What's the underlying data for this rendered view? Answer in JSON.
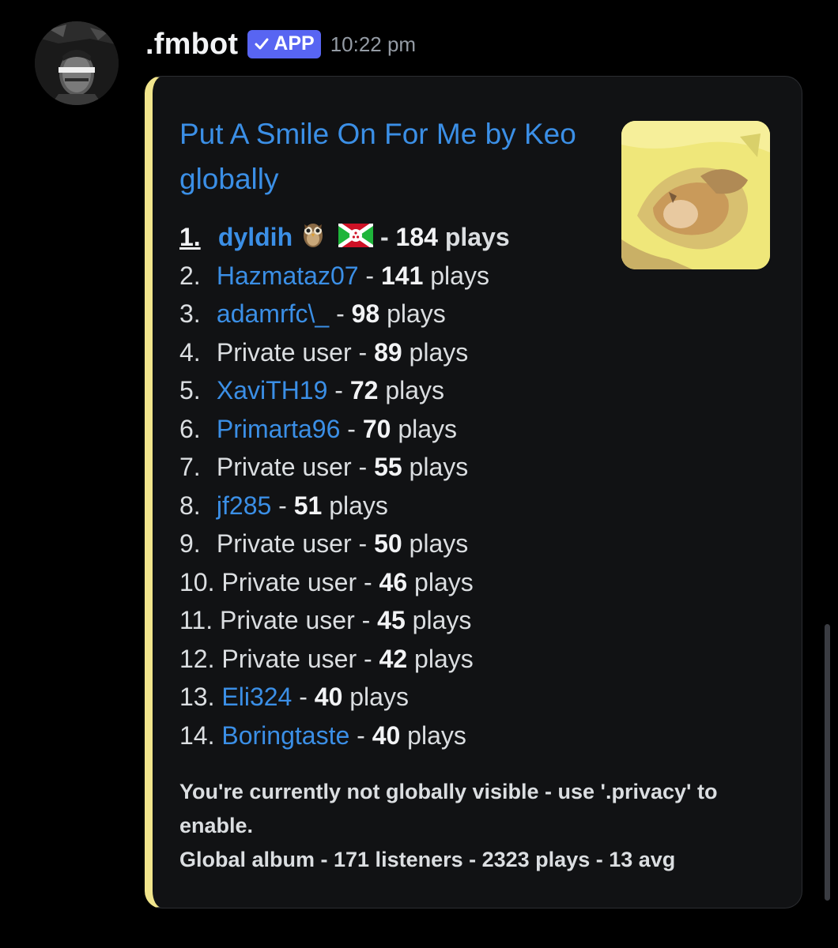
{
  "message": {
    "author": ".fmbot",
    "badge": "APP",
    "timestamp": "10:22 pm",
    "avatar_icon": "user-avatar"
  },
  "embed": {
    "accent_color": "#f1e58c",
    "title": "Put A Smile On For Me by Keo globally",
    "thumbnail_icon": "album-cover",
    "rankings": [
      {
        "rank": "1.",
        "user": "dyldih",
        "plays": "184",
        "suffix": " plays",
        "private": false,
        "emojis": [
          "owl",
          "burundi-flag"
        ]
      },
      {
        "rank": "2.",
        "user": "Hazmataz07",
        "plays": "141",
        "suffix": " plays",
        "private": false
      },
      {
        "rank": "3.",
        "user": "adamrfc\\_",
        "plays": "98",
        "suffix": " plays",
        "private": false
      },
      {
        "rank": "4.",
        "user": "Private user",
        "plays": "89",
        "suffix": " plays",
        "private": true
      },
      {
        "rank": "5.",
        "user": "XaviTH19",
        "plays": "72",
        "suffix": " plays",
        "private": false
      },
      {
        "rank": "6.",
        "user": "Primarta96",
        "plays": "70",
        "suffix": " plays",
        "private": false
      },
      {
        "rank": "7.",
        "user": "Private user",
        "plays": "55",
        "suffix": " plays",
        "private": true
      },
      {
        "rank": "8.",
        "user": "jf285",
        "plays": "51",
        "suffix": " plays",
        "private": false
      },
      {
        "rank": "9.",
        "user": "Private user",
        "plays": "50",
        "suffix": " plays",
        "private": true
      },
      {
        "rank": "10.",
        "user": "Private user",
        "plays": "46",
        "suffix": " plays",
        "private": true
      },
      {
        "rank": "11.",
        "user": "Private user",
        "plays": "45",
        "suffix": " plays",
        "private": true
      },
      {
        "rank": "12.",
        "user": "Private user",
        "plays": "42",
        "suffix": " plays",
        "private": true
      },
      {
        "rank": "13.",
        "user": "Eli324",
        "plays": "40",
        "suffix": " plays",
        "private": false
      },
      {
        "rank": "14.",
        "user": "Boringtaste",
        "plays": "40",
        "suffix": " plays",
        "private": false
      }
    ],
    "footer_line1": "You're currently not globally visible - use '.privacy' to enable.",
    "footer_line2": "Global album - 171 listeners - 2323 plays - 13 avg"
  },
  "colors": {
    "background": "#000000",
    "link": "#3b8fe6",
    "badge": "#5865f2"
  }
}
